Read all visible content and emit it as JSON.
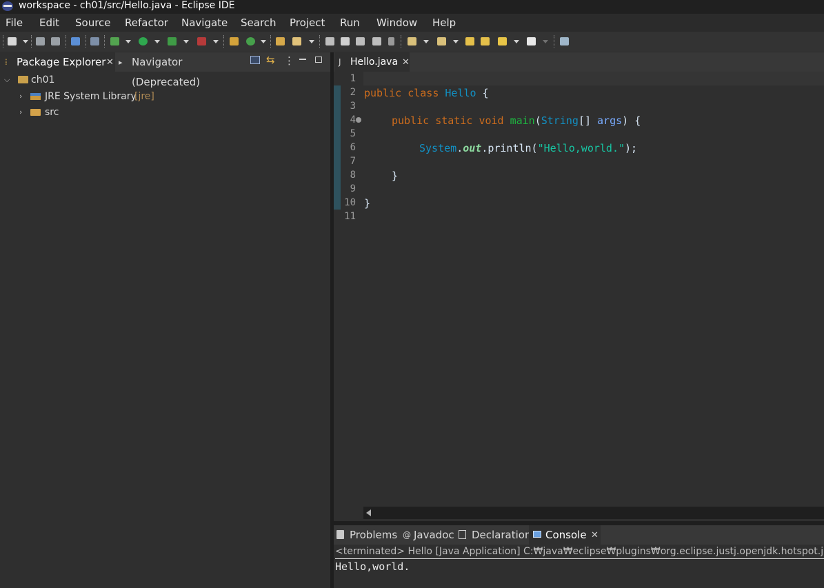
{
  "window": {
    "title": "workspace - ch01/src/Hello.java - Eclipse IDE"
  },
  "menu": [
    "File",
    "Edit",
    "Source",
    "Refactor",
    "Navigate",
    "Search",
    "Project",
    "Run",
    "Window",
    "Help"
  ],
  "left_panel": {
    "tabs": [
      {
        "label": "Package Explorer",
        "active": true,
        "closable": true
      },
      {
        "label": "Navigator (Deprecated)",
        "active": false,
        "closable": false
      }
    ],
    "tree": {
      "project": "ch01",
      "children": [
        {
          "label": "JRE System Library",
          "decoration": "[jre]"
        },
        {
          "label": "src"
        }
      ]
    }
  },
  "editor": {
    "tab_label": "Hello.java",
    "line_numbers": [
      "1",
      "2",
      "3",
      "4",
      "5",
      "6",
      "7",
      "8",
      "9",
      "10",
      "11"
    ],
    "code": {
      "l2": {
        "kw_public": "public",
        "kw_class": "class",
        "class_name": "Hello",
        "brace": " {"
      },
      "l4": {
        "kw_public": "public",
        "kw_static": "static",
        "kw_void": "void",
        "method": "main",
        "open": "(",
        "type": "String",
        "arr": "[] ",
        "param": "args",
        "close": ") {"
      },
      "l6": {
        "obj": "System",
        "dot1": ".",
        "field": "out",
        "dot2": ".println(",
        "str": "\"Hello,world.\"",
        "end": ");"
      },
      "l8": "}",
      "l10": "}"
    }
  },
  "console": {
    "tabs": [
      {
        "label": "Problems",
        "active": false
      },
      {
        "label": "Javadoc",
        "active": false
      },
      {
        "label": "Declaration",
        "active": false
      },
      {
        "label": "Console",
        "active": true
      }
    ],
    "header": "<terminated> Hello [Java Application] C:₩java₩eclipse₩plugins₩org.eclipse.justj.openjdk.hotspot.jre.full",
    "output": "Hello,world."
  },
  "icons": {
    "new": "new-wizard-icon",
    "save": "save-icon",
    "save_all": "save-all-icon",
    "debug": "debug-icon",
    "run": "run-icon",
    "coverage": "coverage-icon",
    "external_tools": "external-tools-icon",
    "new_java_package": "new-package-icon",
    "new_java_class": "new-class-icon",
    "open_type": "open-type-icon",
    "search": "search-icon",
    "back": "back-arrow-icon",
    "forward": "forward-arrow-icon"
  },
  "colors": {
    "keyword": "#cc6c1d",
    "class": "#1290c3",
    "method": "#1eb540",
    "string": "#17c6a3",
    "background": "#2f2f2f"
  }
}
